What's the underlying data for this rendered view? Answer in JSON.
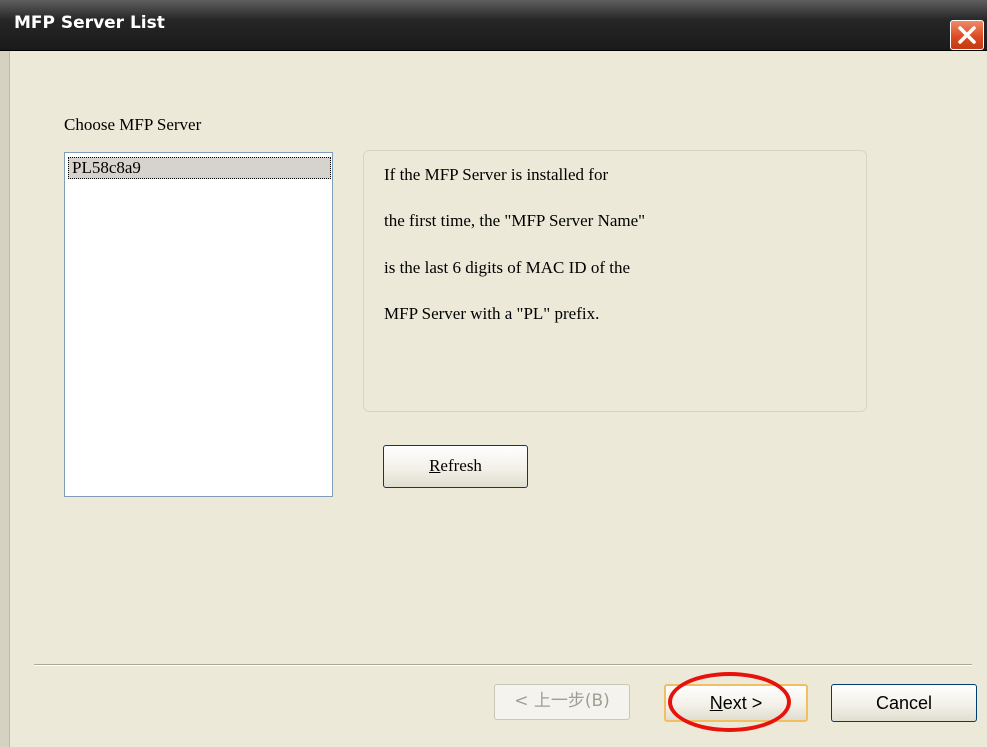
{
  "window": {
    "title": "MFP Server List",
    "close_icon": "close-icon"
  },
  "choose": {
    "label": "Choose MFP Server",
    "items": [
      "PL58c8a9"
    ],
    "selected": "PL58c8a9"
  },
  "info": {
    "lines": [
      "If the MFP Server is installed for",
      "the first time, the \"MFP Server Name\"",
      "is the last 6 digits of MAC ID of the",
      "MFP Server with a \"PL\" prefix."
    ]
  },
  "buttons": {
    "refresh_first": "R",
    "refresh_rest": "efresh",
    "back": "< 上一步(B)",
    "next_first": "N",
    "next_rest": "ext >",
    "cancel": "Cancel"
  },
  "colors": {
    "annotation_circle": "#e8120c",
    "titlebar": "#262626",
    "dialog_bg": "#ece9d8"
  }
}
